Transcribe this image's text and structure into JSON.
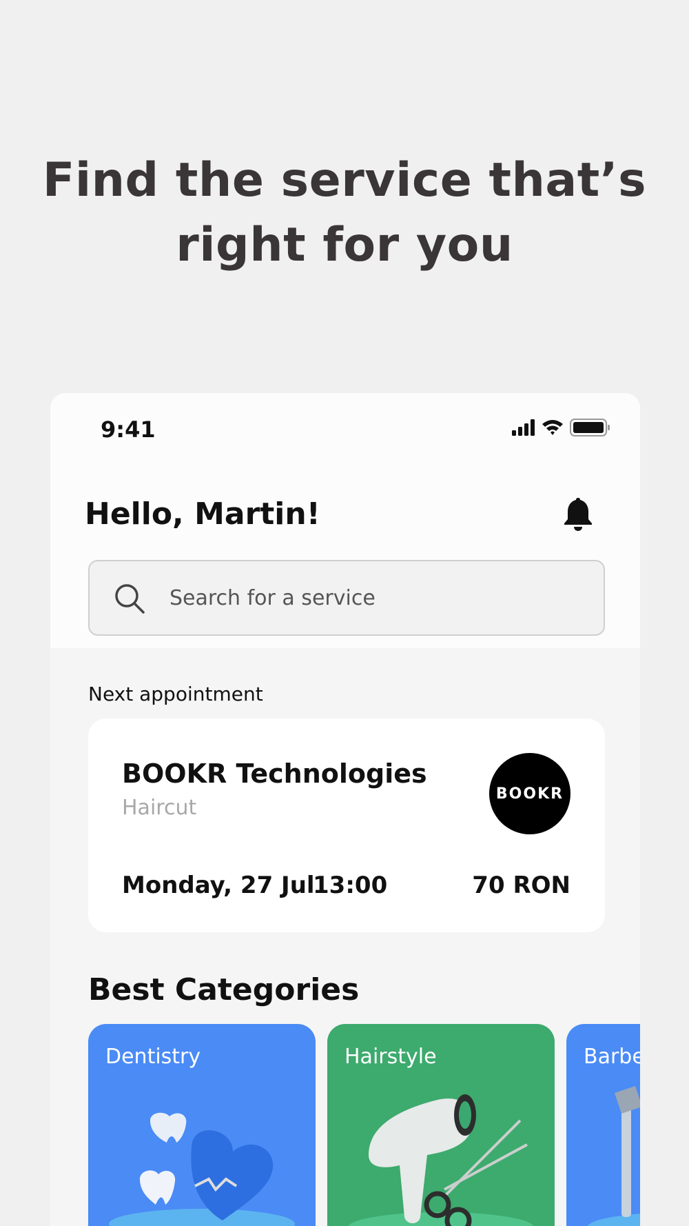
{
  "hero": {
    "line1": "Find the service that’s",
    "line2": "right for you"
  },
  "status": {
    "time": "9:41"
  },
  "header": {
    "greeting": "Hello, Martin!"
  },
  "search": {
    "placeholder": "Search for a service"
  },
  "appointment": {
    "section_label": "Next appointment",
    "company": "BOOKR Technologies",
    "service": "Haircut",
    "logo_text": "BOOKR",
    "date": "Monday, 27 Jul",
    "time": "13:00",
    "price": "70 RON"
  },
  "categories": {
    "title": "Best Categories",
    "items": [
      {
        "label": "Dentistry",
        "color": "#4a8bf5"
      },
      {
        "label": "Hairstyle",
        "color": "#3daa6e"
      },
      {
        "label": "Barbe",
        "color": "#4a8bf5"
      }
    ]
  },
  "colors": {
    "page_bg": "#f0f0f0",
    "hero_text": "#3a3536",
    "blue": "#4a8bf5",
    "green": "#3daa6e"
  },
  "icons": [
    "signal-icon",
    "wifi-icon",
    "battery-icon",
    "bell-icon",
    "search-icon"
  ]
}
